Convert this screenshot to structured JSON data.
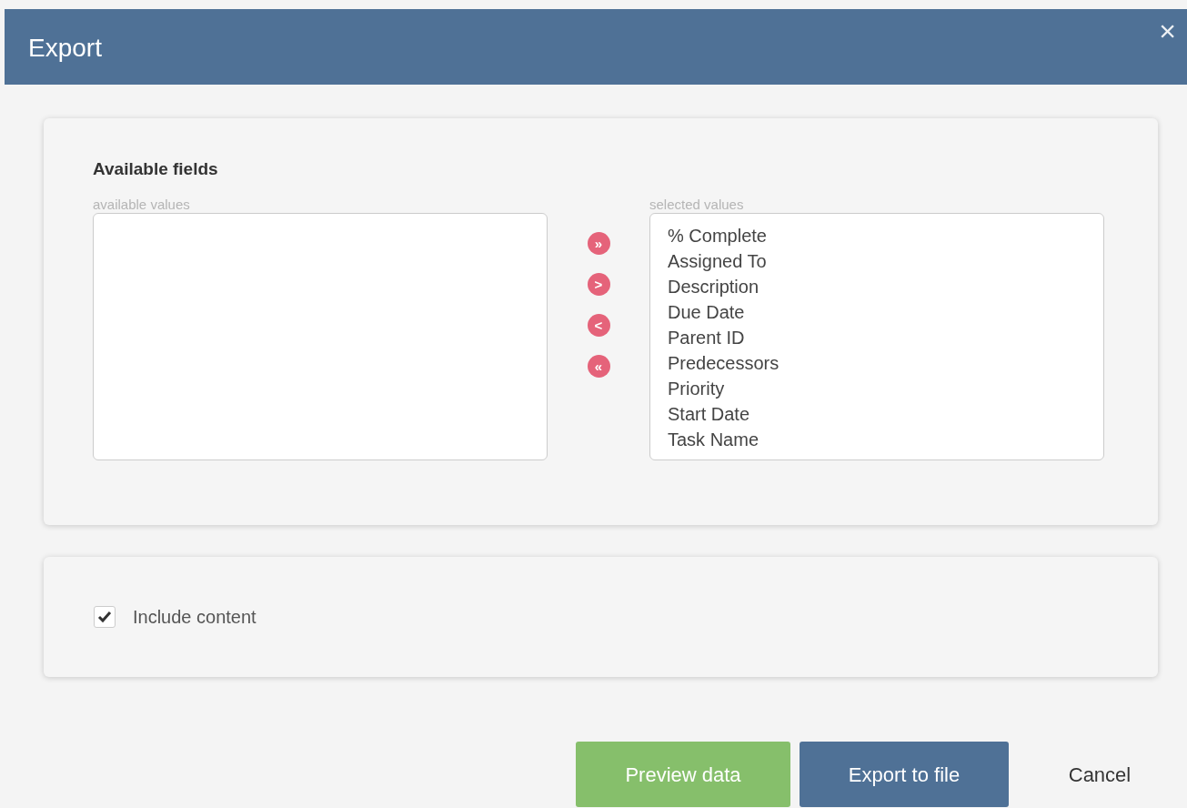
{
  "window": {
    "title": "Export",
    "close": "×"
  },
  "fields": {
    "title": "Available fields",
    "available_label": "available values",
    "selected_label": "selected values",
    "movers": [
      "»",
      ">",
      "<",
      "«"
    ],
    "selected_values": [
      "% Complete",
      "Assigned To",
      "Description",
      "Due Date",
      "Parent ID",
      "Predecessors",
      "Priority",
      "Start Date",
      "Task Name"
    ]
  },
  "options": {
    "include_content": {
      "label": "Include content",
      "checked": true
    }
  },
  "buttons": [
    {
      "label": "Preview data",
      "kind": "success"
    },
    {
      "label": "Export to file",
      "kind": "primary"
    },
    {
      "label": "Cancel",
      "kind": "plain"
    }
  ]
}
